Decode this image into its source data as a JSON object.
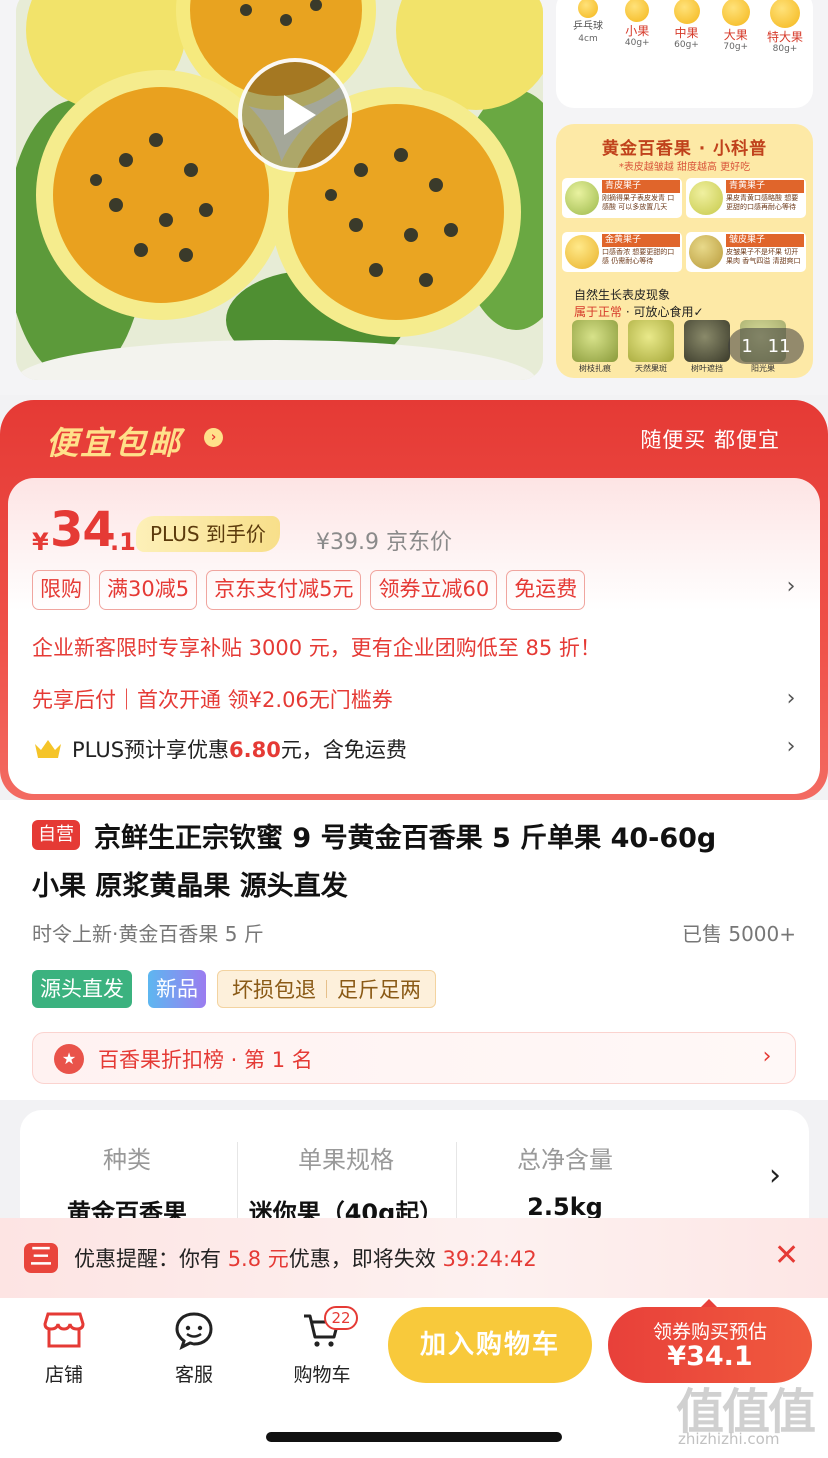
{
  "gallery": {
    "sizes": [
      {
        "name": "乒乓球",
        "sub": "4cm"
      },
      {
        "name": "小果",
        "sub": "40g+"
      },
      {
        "name": "中果",
        "sub": "60g+"
      },
      {
        "name": "大果",
        "sub": "70g+"
      },
      {
        "name": "特大果",
        "sub": "80g+"
      }
    ],
    "guide_title": "黄金百香果 · 小科普",
    "guide_sub": "*表皮越皱越 甜度越高 更好吃",
    "guide_cards": [
      {
        "head": "青皮果子",
        "text": "刚摘得果子表皮发青 口感酸 可以多放置几天"
      },
      {
        "head": "青黄果子",
        "text": "果皮青黄口感略酸 想要更甜的口感再耐心等待"
      },
      {
        "head": "金黄果子",
        "text": "口感香浓 想要更甜的口感 仍需耐心等待"
      },
      {
        "head": "皱皮果子",
        "text": "皮皱果子不是坏果 切开果肉 香气四溢 清甜爽口"
      }
    ],
    "note1": "自然生长表皮现象",
    "note2_red": "属于正常",
    "note2_rest": " · 可放心食用✓",
    "captions": [
      "树枝扎痕",
      "天然果斑",
      "树叶遮挡",
      "阳光果"
    ],
    "page_current": "1",
    "page_total": "11"
  },
  "promo": {
    "title": "便宜包邮",
    "slogan": "随便买 都便宜",
    "currency": "¥",
    "price_int": "34",
    "price_dec": ".1",
    "plus_label": "PLUS 到手价",
    "orig_price": "¥39.9 京东价",
    "tags": [
      "限购",
      "满30减5",
      "京东支付减5元",
      "领券立减60",
      "免运费"
    ],
    "enterprise": "企业新客限时专享补贴 3000 元，更有企业团购低至 85 折！",
    "bnpl": "先享后付｜首次开通 领¥2.06无门槛券",
    "plus_pre": "PLUS预计享优惠",
    "plus_amount": "6.80",
    "plus_post": "元，含免运费"
  },
  "product": {
    "self_tag": "自营",
    "title_line1": "京鲜生正宗钦蜜 9 号黄金百香果 5 斤单果 40-60g",
    "title_line2": "小果 原浆黄晶果 源头直发",
    "subtitle": "时令上新·黄金百香果 5 斤",
    "sold": "已售 5000+",
    "badge_source": "源头直发",
    "badge_new": "新品",
    "badge_refund": "坏损包退",
    "badge_weight": "足斤足两",
    "rank": "百香果折扣榜 · 第 1 名"
  },
  "spec": [
    {
      "label": "种类",
      "value": "黄金百香果"
    },
    {
      "label": "单果规格",
      "value": "迷你果（40g起）"
    },
    {
      "label": "总净含量",
      "value": "2.5kg"
    }
  ],
  "reminder": {
    "pre": "优惠提醒：你有 ",
    "amount": "5.8 元",
    "mid": "优惠，即将失效 ",
    "countdown": "39:24:42"
  },
  "bottom": {
    "shop": "店铺",
    "service": "客服",
    "cart": "购物车",
    "cart_count": "22",
    "add_cart": "加入购物车",
    "buy_line1": "领券购买预估",
    "buy_line2": "¥34.1"
  },
  "watermark": {
    "big": "值值值",
    "small": "zhizhizhi.com"
  },
  "colors": {
    "accent": "#e53a35",
    "cart_yellow": "#f8c93b",
    "gold": "#ffe08a",
    "green_badge": "#3bb27f"
  },
  "icons": [
    "play-icon",
    "chevron-right-icon",
    "crown-icon",
    "medal-icon",
    "store-icon",
    "chat-icon",
    "cart-icon",
    "close-icon",
    "coupon-icon"
  ]
}
